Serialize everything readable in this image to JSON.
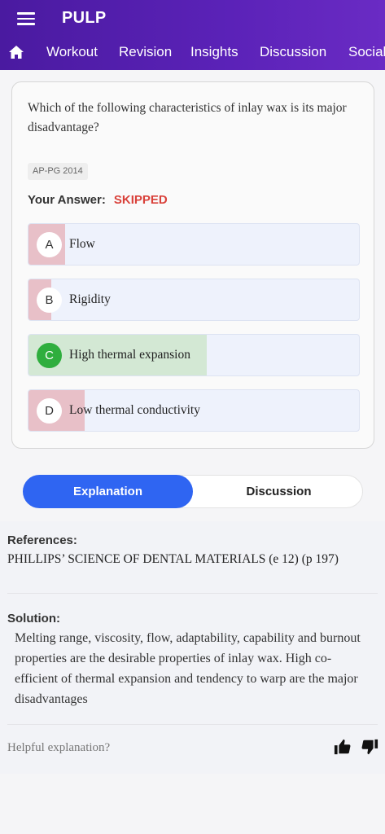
{
  "app": {
    "title": "PULP"
  },
  "nav": {
    "items": [
      {
        "label": "Workout"
      },
      {
        "label": "Revision"
      },
      {
        "label": "Insights"
      },
      {
        "label": "Discussion"
      },
      {
        "label": "Social"
      }
    ]
  },
  "question": {
    "text": "Which of the following characteristics of inlay wax is its major disadvantage?",
    "tag": "AP-PG 2014",
    "answer_label": "Your Answer:",
    "answer_value": "SKIPPED"
  },
  "options": [
    {
      "letter": "A",
      "text": "Flow",
      "percent": 11,
      "correct": false
    },
    {
      "letter": "B",
      "text": "Rigidity",
      "percent": 7,
      "correct": false
    },
    {
      "letter": "C",
      "text": "High thermal expansion",
      "percent": 54,
      "correct": true
    },
    {
      "letter": "D",
      "text": "Low thermal conductivity",
      "percent": 17,
      "correct": false
    }
  ],
  "tabs": {
    "explanation": "Explanation",
    "discussion": "Discussion"
  },
  "references": {
    "title": "References:",
    "text": "PHILLIPS’ SCIENCE OF DENTAL MATERIALS (e 12) (p 197)"
  },
  "solution": {
    "title": "Solution:",
    "text": "Melting range, viscosity, flow, adaptability, capability and burnout properties are the desirable properties of inlay wax. High co-efficient of thermal expansion and tendency to warp are the major disadvantages"
  },
  "feedback": {
    "prompt": "Helpful explanation?"
  },
  "colors": {
    "appbar": "#5b22b8",
    "wrong_fill": "#e8c0c8",
    "correct_fill": "#d3e8d4",
    "correct_circle": "#2fae3e",
    "skipped": "#d9413a",
    "active_tab": "#2f65f2"
  }
}
